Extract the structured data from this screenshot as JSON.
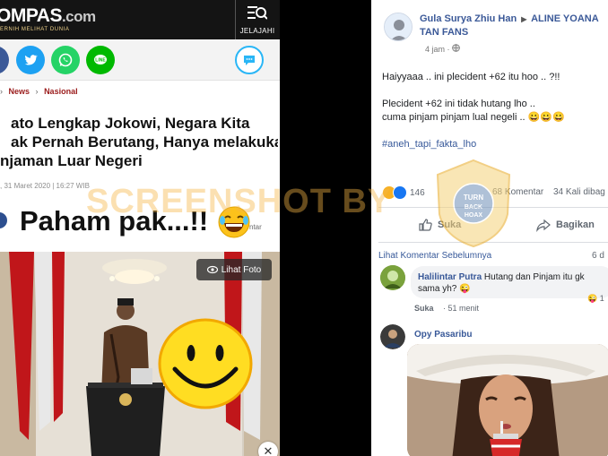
{
  "article": {
    "logo": "OMPAS",
    "logo_suffix": ".com",
    "tagline": "ERNIH MELIHAT DUNIA",
    "explore_label": "JELAJAHI",
    "breadcrumb": [
      "News",
      "Nasional"
    ],
    "headline_lines": [
      "ato Lengkap Jokowi, Negara Kita",
      "ak Pernah Berutang, Hanya melakukan",
      "njaman Luar Negeri"
    ],
    "date": ", 31 Maret 2020 | 16:27 WIB",
    "caption": "Paham pak...!!",
    "caption_tail": "ntar",
    "photo_button": "Lihat Foto",
    "close_symbol": "✕"
  },
  "post": {
    "author": "Gula Surya Zhiu Han",
    "target": "ALINE YOANA TAN FANS",
    "time": "4 jam",
    "lines": [
      "Haiyyaaa .. ini plecident +62 itu hoo .. ?!!",
      "Plecident +62 ini tidak hutang lho ..",
      "cuma pinjam pinjam lual negeli .. 😀😀😀"
    ],
    "hashtag": "#aneh_tapi_fakta_lho",
    "reaction_count": "146",
    "comments": "68 Komentar",
    "shares": "34 Kali dibag",
    "like_label": "Suka",
    "share_label": "Bagikan",
    "prev_comments": "Lihat Komentar Sebelumnya",
    "prev_time": "6 d",
    "comment1": {
      "name": "Halilintar Putra",
      "text": "Hutang dan Pinjam itu gk sama yh? 😜",
      "like": "Suka",
      "time": "51 menit",
      "badge": "😜 1"
    },
    "comment2": {
      "name": "Opy Pasaribu"
    }
  },
  "overlay": {
    "watermark": "SCREENSHOT BY",
    "seal_text": "TURN BACK HOAX"
  },
  "colors": {
    "facebook": "#1877f2",
    "twitter": "#1da1f2",
    "whatsapp": "#25d366",
    "line": "#00b900",
    "link_blue": "#3b5998",
    "kompas_dark": "#141414"
  }
}
